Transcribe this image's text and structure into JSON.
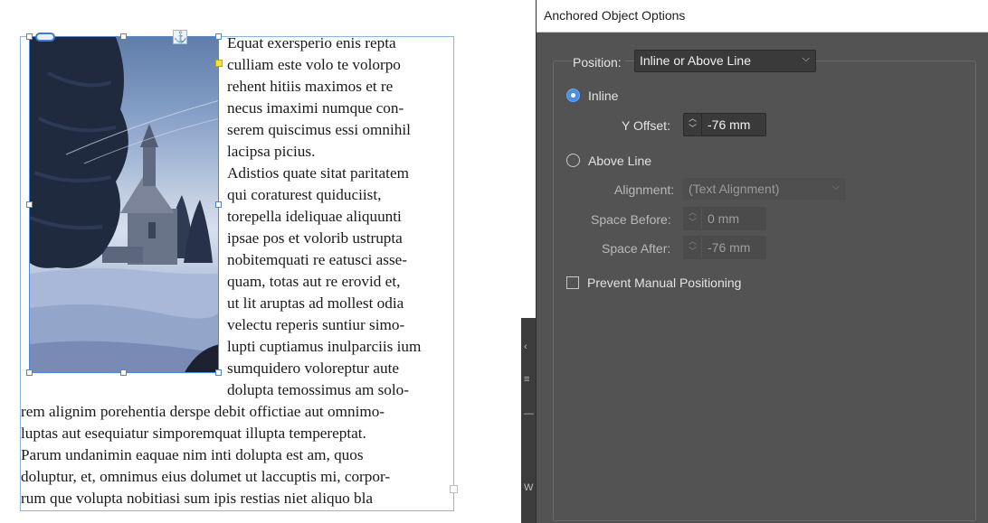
{
  "document": {
    "lines": [
      "Equat exersperio enis repta",
      "culliam este volo te volorpo",
      "rehent hitiis maximos et re",
      "necus imaximi numque con-",
      "serem quiscimus essi omnihil",
      "lacipsa picius.",
      "Adistios quate sitat paritatem",
      "qui coraturest quiduciist,",
      "torepella ideliquae aliquunti",
      "ipsae pos et volorib ustrupta",
      "nobitemquati re eatusci asse-",
      "quam, totas aut re erovid et,",
      "ut lit aruptas ad mollest odia",
      "velectu reperis suntiur simo-",
      "lupti cuptiamus inulparciis ium",
      "sumquidero voloreptur aute",
      "dolupta temossimus am solo-",
      "rem alignim porehentia derspe debit offictiae aut omnimo-",
      "luptas aut esequiatur simporemquat illupta tempereptat.",
      "Parum undanimin eaquae nim inti dolupta est am, quos",
      "doluptur, et, omnimus eius dolumet ut laccuptis mi, corpor-",
      "rum que volupta nobitiasi sum ipis restias niet aliquo bla"
    ]
  },
  "panel_sliver": {
    "glyphs": [
      "‹",
      "≡",
      "—",
      "W"
    ]
  },
  "dialog": {
    "title": "Anchored Object Options",
    "position_label": "Position:",
    "position_value": "Inline or Above Line",
    "inline_label": "Inline",
    "y_offset_label": "Y Offset:",
    "y_offset_value": "-76 mm",
    "above_line_label": "Above Line",
    "alignment_label": "Alignment:",
    "alignment_value": "(Text Alignment)",
    "space_before_label": "Space Before:",
    "space_before_value": "0 mm",
    "space_after_label": "Space After:",
    "space_after_value": "-76 mm",
    "prevent_label": "Prevent Manual Positioning",
    "inline_selected": true,
    "prevent_checked": false
  },
  "colors": {
    "dialog_bg": "#535353",
    "accent_radio": "#4a90e2",
    "frame_border": "#8fb3d9"
  },
  "icons": {
    "anchor": "anchor-icon",
    "link": "link-icon",
    "chevron": "chevron-down-icon",
    "spinner": "spinner-arrows-icon"
  }
}
